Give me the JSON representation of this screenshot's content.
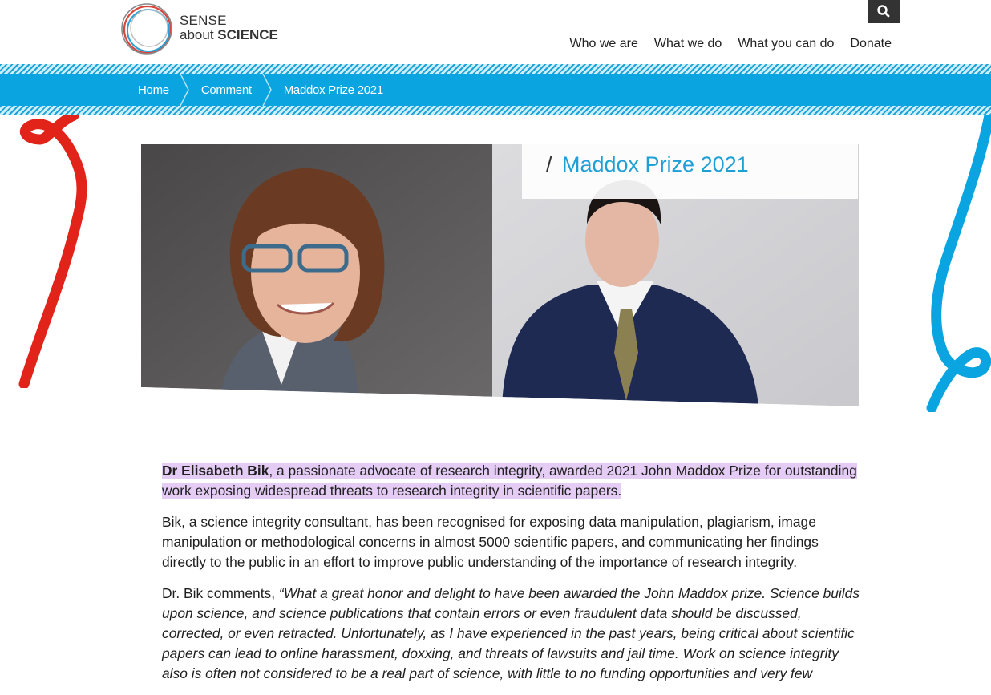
{
  "logo": {
    "line1": "SENSE",
    "line2_about": "about",
    "line2_science": "SCIENCE"
  },
  "header": {
    "nav": [
      "Who we are",
      "What we do",
      "What you can do",
      "Donate"
    ],
    "search_icon": "search-icon"
  },
  "breadcrumb": {
    "items": [
      "Home",
      "Comment"
    ],
    "current": "Maddox Prize 2021"
  },
  "hero": {
    "slash": "/",
    "title": "Maddox Prize 2021"
  },
  "article": {
    "lead_bold": "Dr Elisabeth Bik",
    "lead_rest": ", a passionate advocate of research integrity, awarded 2021 John Maddox Prize for outstanding work exposing widespread threats to research integrity in scientific papers.",
    "para2": "Bik, a science integrity consultant, has been recognised for exposing data manipulation, plagiarism, image manipulation or methodological concerns in almost 5000 scientific papers, and communicating her findings directly to the public in an effort to improve public understanding of the importance of research integrity.",
    "para3_intro": "Dr. Bik comments, ",
    "para3_quote": "“What a great honor and delight to have been awarded the John Maddox prize. Science builds upon science, and science publications that contain errors or even fraudulent data should be discussed, corrected, or even retracted. Unfortunately, as I have experienced in the past years, being critical about scientific papers can lead to online harassment, doxxing, and threats of lawsuits and jail time.  Work on science integrity also is often not considered to be a real part of science, with little to no funding opportunities and very few"
  },
  "colors": {
    "accent_blue": "#0aa5e0",
    "title_blue": "#1ea0d6",
    "highlight": "#e5ccf5",
    "ribbon_red": "#e2231a"
  }
}
